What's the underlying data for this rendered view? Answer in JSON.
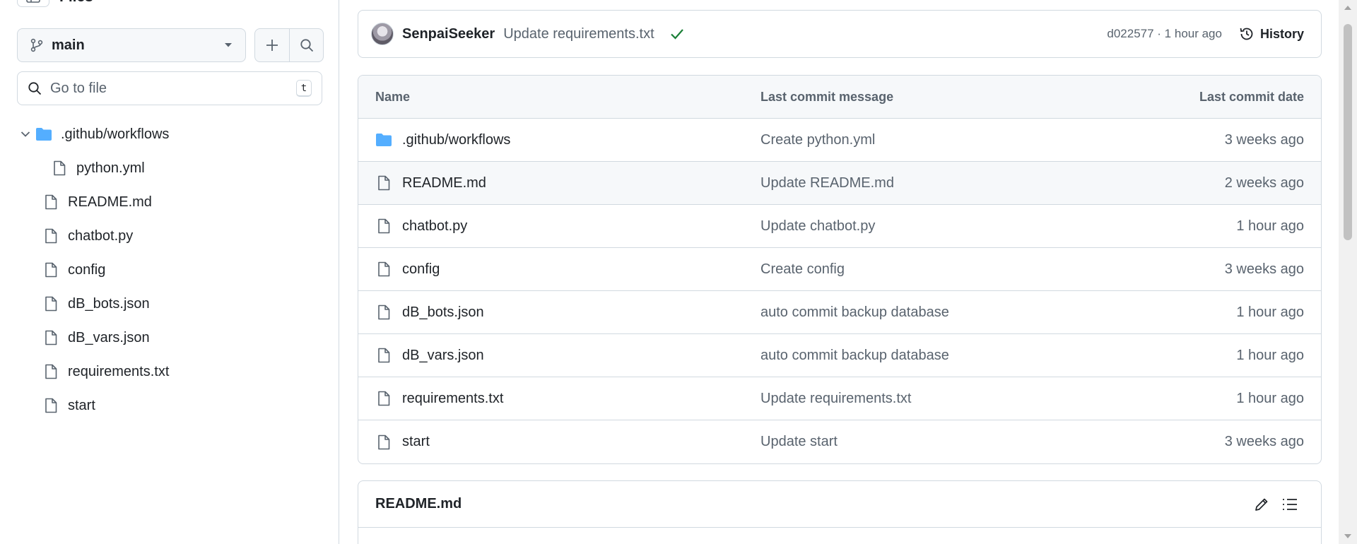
{
  "sidebar": {
    "title": "Files",
    "branch": "main",
    "search_placeholder": "Go to file",
    "search_shortcut": "t",
    "tree": [
      {
        "label": ".github/workflows",
        "type": "folder",
        "expanded": true,
        "depth": 0
      },
      {
        "label": "python.yml",
        "type": "file",
        "depth": 1
      },
      {
        "label": "README.md",
        "type": "file",
        "depth": 0
      },
      {
        "label": "chatbot.py",
        "type": "file",
        "depth": 0
      },
      {
        "label": "config",
        "type": "file",
        "depth": 0
      },
      {
        "label": "dB_bots.json",
        "type": "file",
        "depth": 0
      },
      {
        "label": "dB_vars.json",
        "type": "file",
        "depth": 0
      },
      {
        "label": "requirements.txt",
        "type": "file",
        "depth": 0
      },
      {
        "label": "start",
        "type": "file",
        "depth": 0
      }
    ]
  },
  "commit": {
    "author": "SenpaiSeeker",
    "message": "Update requirements.txt",
    "status": "success",
    "sha_time": "d022577 · 1 hour ago",
    "history_label": "History"
  },
  "files": {
    "headers": {
      "name": "Name",
      "message": "Last commit message",
      "date": "Last commit date"
    },
    "rows": [
      {
        "name": ".github/workflows",
        "type": "folder",
        "message": "Create python.yml",
        "date": "3 weeks ago"
      },
      {
        "name": "README.md",
        "type": "file",
        "message": "Update README.md",
        "date": "2 weeks ago"
      },
      {
        "name": "chatbot.py",
        "type": "file",
        "message": "Update chatbot.py",
        "date": "1 hour ago"
      },
      {
        "name": "config",
        "type": "file",
        "message": "Create config",
        "date": "3 weeks ago"
      },
      {
        "name": "dB_bots.json",
        "type": "file",
        "message": "auto commit backup database",
        "date": "1 hour ago"
      },
      {
        "name": "dB_vars.json",
        "type": "file",
        "message": "auto commit backup database",
        "date": "1 hour ago"
      },
      {
        "name": "requirements.txt",
        "type": "file",
        "message": "Update requirements.txt",
        "date": "1 hour ago"
      },
      {
        "name": "start",
        "type": "file",
        "message": "Update start",
        "date": "3 weeks ago"
      }
    ]
  },
  "readme": {
    "title": "README.md"
  },
  "colors": {
    "folder": "#54aeff",
    "success": "#1a7f37",
    "border": "#d1d9e0",
    "muted": "#59636e"
  }
}
